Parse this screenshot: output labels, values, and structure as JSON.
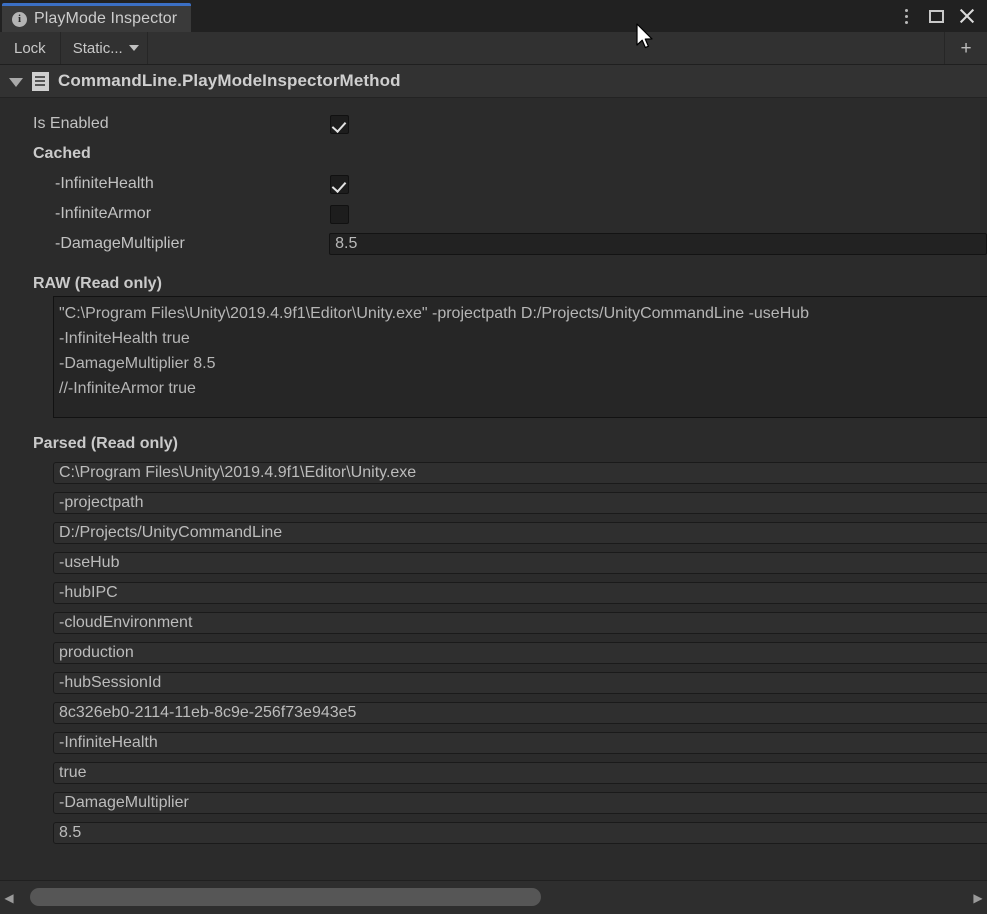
{
  "window": {
    "tab_label": "PlayMode Inspector",
    "tab_icon": "info-icon",
    "menu_icon": "kebab-menu-icon",
    "maximize_icon": "maximize-icon",
    "close_icon": "close-icon",
    "accent_color": "#3b6fc4",
    "background_color": "#2b2b2b"
  },
  "toolbar": {
    "lock_label": "Lock",
    "static_label": "Static...",
    "dropdown_icon": "chevron-down-icon",
    "add_label": "+"
  },
  "component": {
    "foldout_icon": "foldout-triangle-down-icon",
    "script_icon": "script-document-icon",
    "title": "CommandLine.PlayModeInspectorMethod"
  },
  "properties": {
    "is_enabled": {
      "label": "Is Enabled",
      "value": true
    },
    "cached_label": "Cached",
    "cached": [
      {
        "label": "-InfiniteHealth",
        "type": "checkbox",
        "value": true
      },
      {
        "label": "-InfiniteArmor",
        "type": "checkbox",
        "value": false
      },
      {
        "label": "-DamageMultiplier",
        "type": "text",
        "value": "8.5"
      }
    ]
  },
  "raw": {
    "label": "RAW (Read only)",
    "lines": [
      "\"C:\\Program Files\\Unity\\2019.4.9f1\\Editor\\Unity.exe\" -projectpath D:/Projects/UnityCommandLine -useHub",
      "-InfiniteHealth true",
      "-DamageMultiplier 8.5",
      "//-InfiniteArmor true"
    ]
  },
  "parsed": {
    "label": "Parsed (Read only)",
    "items": [
      "C:\\Program Files\\Unity\\2019.4.9f1\\Editor\\Unity.exe",
      "-projectpath",
      "D:/Projects/UnityCommandLine",
      "-useHub",
      "-hubIPC",
      "-cloudEnvironment",
      "production",
      "-hubSessionId",
      "8c326eb0-2114-11eb-8c9e-256f73e943e5",
      "-InfiniteHealth",
      "true",
      "-DamageMultiplier",
      "8.5"
    ]
  },
  "scrollbar": {
    "left_arrow": "◀",
    "right_arrow": "▶"
  }
}
